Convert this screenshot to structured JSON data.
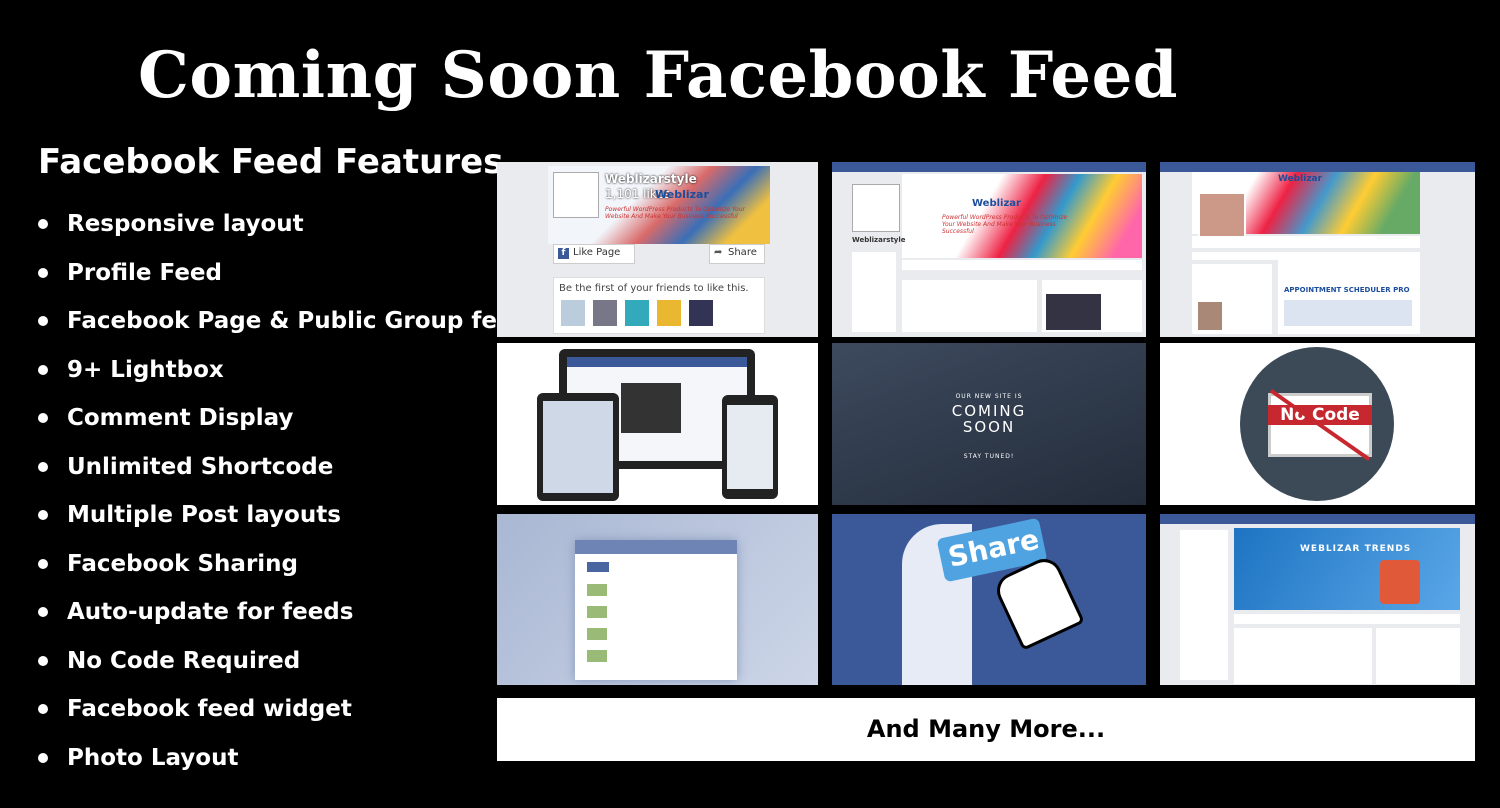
{
  "header": {
    "title": "Coming Soon Facebook Feed"
  },
  "features": {
    "heading": "Facebook Feed Features",
    "items": [
      "Responsive layout",
      "Profile Feed",
      "Facebook Page & Public  Group feeds",
      "9+ Lightbox",
      "Comment Display",
      "Unlimited Shortcode",
      "Multiple Post layouts",
      "Facebook Sharing",
      "Auto-update for feeds",
      "No Code Required",
      "Facebook feed widget",
      "Photo Layout"
    ]
  },
  "tiles": {
    "page_plugin": {
      "page_name": "Weblizarstyle",
      "likes": "1,101 likes",
      "brand": "Weblizar",
      "tagline": "Powerful WordPress Products To Optimize Your Website And Make Your Business Successful",
      "like_button": "Like Page",
      "share_button": "Share",
      "friends_text": "Be the first of your friends to like this."
    },
    "profile_page": {
      "brand": "Weblizar",
      "page_name": "Weblizarstyle",
      "tagline": "Powerful WordPress Products To Optimize Your Website And Make Your Business Successful"
    },
    "timeline": {
      "brand": "Weblizar",
      "banner": "APPOINTMENT SCHEDULER PRO"
    },
    "coming_soon": {
      "small": "OUR NEW SITE IS",
      "big_line1": "COMING",
      "big_line2": "SOON",
      "sub": "STAY TUNED!"
    },
    "no_code": {
      "label": "No Code"
    },
    "share": {
      "label": "Share"
    },
    "group": {
      "title": "WEBLIZAR TRENDS"
    }
  },
  "more": {
    "label": "And Many More..."
  },
  "colors": {
    "background": "#000000",
    "facebook_blue": "#3b5998",
    "text": "#ffffff"
  }
}
